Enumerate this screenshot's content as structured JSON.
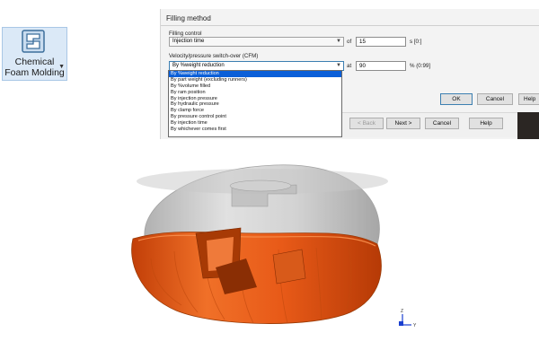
{
  "ribbon": {
    "label_line1": "Chemical",
    "label_line2": "Foam Molding",
    "icon": "mold-icon",
    "accent": "#dbe9f7"
  },
  "dialog": {
    "title": "Filling method",
    "filling_control": {
      "section_label": "Filling control",
      "value": "Injection time",
      "of_label": "of",
      "amount": "15",
      "unit": "s [0:]"
    },
    "switchover": {
      "section_label": "Velocity/pressure switch-over (CFM)",
      "value": "By %weight reduction",
      "at_label": "at",
      "amount": "90",
      "unit": "% (0:99]",
      "options": [
        "By %weight reduction",
        "By part weight (excluding runners)",
        "By %volume filled",
        "By ram position",
        "By injection pressure",
        "By hydraulic pressure",
        "By clamp force",
        "By pressure control point",
        "By injection time",
        "By whichever comes first"
      ],
      "selected_index": 0
    },
    "buttons": {
      "ok": "OK",
      "cancel": "Cancel",
      "help": "Help"
    }
  },
  "wizard": {
    "back": "< Back",
    "next": "Next >",
    "cancel": "Cancel",
    "help": "Help"
  },
  "viewport": {
    "axis_z": "Z",
    "axis_y": "Y",
    "model_colors": {
      "shell": "#b8b8b8",
      "fill": "#e8561a"
    }
  }
}
